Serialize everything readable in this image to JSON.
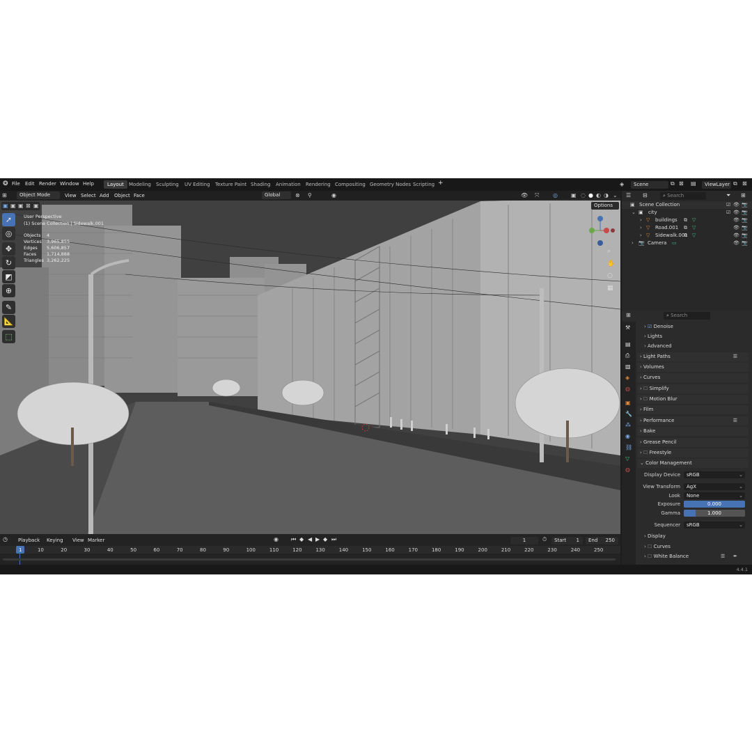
{
  "topbar": {
    "menus": [
      "File",
      "Edit",
      "Render",
      "Window",
      "Help"
    ],
    "workspaces": [
      {
        "label": "Layout",
        "active": true
      },
      {
        "label": "Modeling",
        "active": false
      },
      {
        "label": "Sculpting",
        "active": false
      },
      {
        "label": "UV Editing",
        "active": false
      },
      {
        "label": "Texture Paint",
        "active": false
      },
      {
        "label": "Shading",
        "active": false
      },
      {
        "label": "Animation",
        "active": false
      },
      {
        "label": "Rendering",
        "active": false
      },
      {
        "label": "Compositing",
        "active": false
      },
      {
        "label": "Geometry Nodes",
        "active": false
      },
      {
        "label": "Scripting",
        "active": false
      }
    ],
    "add_tab": "+",
    "scene": "Scene",
    "view_layer": "ViewLayer"
  },
  "viewport": {
    "mode": "Object Mode",
    "menus": [
      "View",
      "Select",
      "Add",
      "Object",
      "Face"
    ],
    "orientation": "Global",
    "options": "Options",
    "info": {
      "perspective": "User Perspective",
      "collection": "(1) Scene Collection | Sidewalk.001",
      "stats": [
        {
          "label": "Objects",
          "value": "4"
        },
        {
          "label": "Vertices",
          "value": "3,965,855"
        },
        {
          "label": "Edges",
          "value": "5,606,857"
        },
        {
          "label": "Faces",
          "value": "1,714,888"
        },
        {
          "label": "Triangles",
          "value": "3,262,225"
        }
      ]
    },
    "tools": [
      "select-box",
      "cursor",
      "move",
      "rotate",
      "scale",
      "transform",
      "annotate",
      "measure",
      "add-cube"
    ]
  },
  "timeline": {
    "menus": [
      "Playback",
      "Keying",
      "View",
      "Marker"
    ],
    "current_frame": "1",
    "start_label": "Start",
    "start": "1",
    "end_label": "End",
    "end": "250",
    "ticks": [
      "1",
      "10",
      "20",
      "30",
      "40",
      "50",
      "60",
      "70",
      "80",
      "90",
      "100",
      "110",
      "120",
      "130",
      "140",
      "150",
      "160",
      "170",
      "180",
      "190",
      "200",
      "210",
      "220",
      "230",
      "240",
      "250"
    ]
  },
  "outliner": {
    "search_placeholder": "Search",
    "items": [
      {
        "label": "Scene Collection",
        "level": 0
      },
      {
        "label": "city",
        "level": 1
      },
      {
        "label": "buildings",
        "level": 2
      },
      {
        "label": "Road.001",
        "level": 2
      },
      {
        "label": "Sidewalk.001",
        "level": 2
      },
      {
        "label": "Camera",
        "level": 1
      }
    ]
  },
  "properties": {
    "search_placeholder": "Search",
    "sections": [
      {
        "label": "Denoise",
        "checkbox": true,
        "checked": true,
        "sub": true
      },
      {
        "label": "Lights",
        "sub": true
      },
      {
        "label": "Advanced",
        "sub": true
      },
      {
        "label": "Light Paths",
        "list": true
      },
      {
        "label": "Volumes"
      },
      {
        "label": "Curves"
      },
      {
        "label": "Simplify",
        "checkbox": true
      },
      {
        "label": "Motion Blur",
        "checkbox": true
      },
      {
        "label": "Film"
      },
      {
        "label": "Performance",
        "list": true
      },
      {
        "label": "Bake"
      },
      {
        "label": "Grease Pencil"
      },
      {
        "label": "Freestyle",
        "checkbox": true
      },
      {
        "label": "Color Management",
        "open": true
      }
    ],
    "color_management": {
      "display_device_label": "Display Device",
      "display_device": "sRGB",
      "view_transform_label": "View Transform",
      "view_transform": "AgX",
      "look_label": "Look",
      "look": "None",
      "exposure_label": "Exposure",
      "exposure": "0.000",
      "gamma_label": "Gamma",
      "gamma": "1.000",
      "sequencer_label": "Sequencer",
      "sequencer": "sRGB",
      "subpanels": [
        "Display",
        "Curves",
        "White Balance"
      ]
    }
  },
  "statusbar": {
    "version": "4.4.1"
  },
  "colors": {
    "accent": "#4772b3",
    "bg": "#1d1d1d",
    "viewport": "#3e3e3e",
    "orange": "#e08a3a",
    "green": "#45c28a"
  }
}
